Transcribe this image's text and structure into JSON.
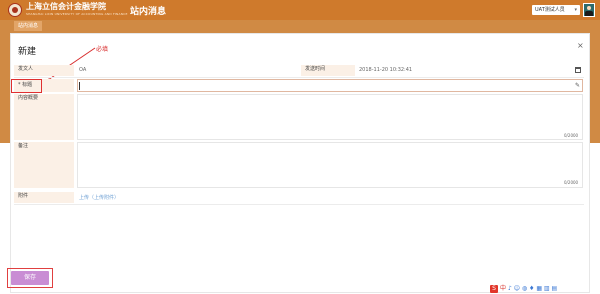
{
  "header": {
    "logo_title": "上海立信会计金融学院",
    "logo_subtitle": "SHANGHAI LIXIN UNIVERSITY OF ACCOUNTING AND FINANCE",
    "page_title": "站内消息",
    "user_name": "UAT测试人员",
    "user_caret": "▾"
  },
  "breadcrumb": {
    "current": "站内消息"
  },
  "modal": {
    "title": "新建",
    "close": "×",
    "annotation": "必填",
    "fields": {
      "sender_label": "发文人",
      "sender_value": "OA",
      "send_time_label": "发送时间",
      "send_time_value": "2018-11-20 10:32:41",
      "subject_label": "* 标题",
      "subject_value": "",
      "content_label": "内容概要",
      "content_counter": "0/2000",
      "remark_label": "备注",
      "remark_counter": "0/2000",
      "attachment_label": "附件",
      "upload_text": "上传（上传附件）"
    },
    "save_label": "保存"
  },
  "watermark": {
    "s_letter": "S",
    "text": "中",
    "icons": "♪ ☺ ◍ ♦ ▦ ▥ ▤"
  },
  "colors": {
    "header_orange": "#cf7a2c",
    "label_bg": "#fbf0e6",
    "annotation_red": "#d82b2b",
    "save_button": "#c98dd4"
  }
}
